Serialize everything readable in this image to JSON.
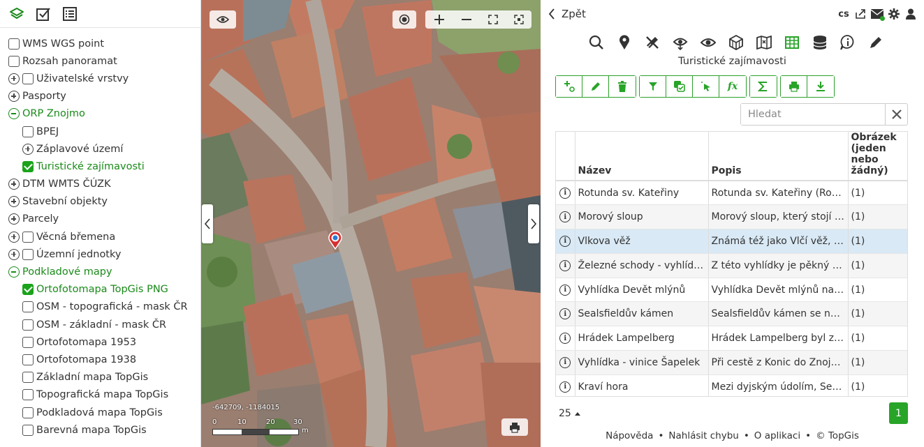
{
  "left_toolbar": {
    "icons": [
      "layers-icon",
      "checklist-icon",
      "list-icon"
    ]
  },
  "layers": [
    {
      "label": "WMS WGS point",
      "checkbox": true,
      "checked": false,
      "expander": null,
      "indent": 0,
      "green": false
    },
    {
      "label": "Rozsah panoramat",
      "checkbox": true,
      "checked": false,
      "expander": null,
      "indent": 0,
      "green": false
    },
    {
      "label": "Uživatelské vrstvy",
      "checkbox": true,
      "checked": false,
      "expander": "plus",
      "indent": 0,
      "green": false
    },
    {
      "label": "Pasporty",
      "checkbox": false,
      "checked": false,
      "expander": "plus",
      "indent": 0,
      "green": false
    },
    {
      "label": "ORP Znojmo",
      "checkbox": false,
      "checked": false,
      "expander": "minus",
      "indent": 0,
      "green": true
    },
    {
      "label": "BPEJ",
      "checkbox": true,
      "checked": false,
      "expander": null,
      "indent": 1,
      "green": false
    },
    {
      "label": "Záplavové území",
      "checkbox": false,
      "checked": false,
      "expander": "plus",
      "indent": 1,
      "green": false
    },
    {
      "label": "Turistické zajímavosti",
      "checkbox": true,
      "checked": true,
      "expander": null,
      "indent": 1,
      "green": true
    },
    {
      "label": "DTM WMTS ČÚZK",
      "checkbox": false,
      "checked": false,
      "expander": "plus",
      "indent": 0,
      "green": false
    },
    {
      "label": "Stavební objekty",
      "checkbox": false,
      "checked": false,
      "expander": "plus",
      "indent": 0,
      "green": false
    },
    {
      "label": "Parcely",
      "checkbox": false,
      "checked": false,
      "expander": "plus",
      "indent": 0,
      "green": false
    },
    {
      "label": "Věcná břemena",
      "checkbox": true,
      "checked": false,
      "expander": "plus",
      "indent": 0,
      "green": false
    },
    {
      "label": "Územní jednotky",
      "checkbox": true,
      "checked": false,
      "expander": "plus",
      "indent": 0,
      "green": false
    },
    {
      "label": "Podkladové mapy",
      "checkbox": false,
      "checked": false,
      "expander": "minus",
      "indent": 0,
      "green": true
    },
    {
      "label": "Ortofotomapa TopGis PNG",
      "checkbox": true,
      "checked": true,
      "expander": null,
      "indent": 1,
      "green": true
    },
    {
      "label": "OSM - topografická - mask ČR",
      "checkbox": true,
      "checked": false,
      "expander": null,
      "indent": 1,
      "green": false
    },
    {
      "label": "OSM - základní - mask ČR",
      "checkbox": true,
      "checked": false,
      "expander": null,
      "indent": 1,
      "green": false
    },
    {
      "label": "Ortofotomapa 1953",
      "checkbox": true,
      "checked": false,
      "expander": null,
      "indent": 1,
      "green": false
    },
    {
      "label": "Ortofotomapa 1938",
      "checkbox": true,
      "checked": false,
      "expander": null,
      "indent": 1,
      "green": false
    },
    {
      "label": "Základní mapa TopGis",
      "checkbox": true,
      "checked": false,
      "expander": null,
      "indent": 1,
      "green": false
    },
    {
      "label": "Topografická mapa TopGis",
      "checkbox": true,
      "checked": false,
      "expander": null,
      "indent": 1,
      "green": false
    },
    {
      "label": "Podkladová mapa TopGis",
      "checkbox": true,
      "checked": false,
      "expander": null,
      "indent": 1,
      "green": false
    },
    {
      "label": "Barevná mapa TopGis",
      "checkbox": true,
      "checked": false,
      "expander": null,
      "indent": 1,
      "green": false
    }
  ],
  "map": {
    "coordinates": "-642709, -1184015",
    "scale_labels": [
      "0",
      "10",
      "20",
      "30"
    ],
    "scale_unit": "m"
  },
  "right": {
    "back_label": "Zpět",
    "language": "cs",
    "section_title": "Turistické zajímavosti",
    "search_placeholder": "Hledat",
    "columns": [
      "Název",
      "Popis",
      "Obrázek (jeden nebo žádný)"
    ],
    "rows": [
      {
        "name": "Rotunda sv. Kateřiny",
        "desc": "Rotunda sv. Kateřiny (Rotunda Panny Marie a sv. Kateřiny)",
        "img": "(1)"
      },
      {
        "name": "Morový sloup",
        "desc": "Morový sloup, který stojí na Horním náměstí",
        "img": "(1)"
      },
      {
        "name": "Vlkova věž",
        "desc": "Známá též jako Vlčí věž, byla součástí",
        "img": "(1)"
      },
      {
        "name": "Železné schody - vyhlídka",
        "desc": "Z této vyhlídky je pěkný pohled na Dyji",
        "img": "(1)"
      },
      {
        "name": "Vyhlídka Devět mlýnů",
        "desc": "Vyhlídka Devět mlýnů nad údolím Dyje",
        "img": "(1)"
      },
      {
        "name": "Sealsfieldův kámen",
        "desc": "Sealsfieldův kámen se nachází nad Dyjí",
        "img": "(1)"
      },
      {
        "name": "Hrádek Lampelberg",
        "desc": "Hrádek Lampelberg byl zbudován",
        "img": "(1)"
      },
      {
        "name": "Vyhlídka - vinice Šapelek",
        "desc": "Při cestě z Konic do Znojma se nachází",
        "img": "(1)"
      },
      {
        "name": "Kraví hora",
        "desc": "Mezi dyjským údolím, Sedlešovicemi a",
        "img": "(1)"
      }
    ],
    "selected_row": 2,
    "page_size": "25",
    "current_page": "1",
    "footer": [
      "Nápověda",
      "Nahlásit chybu",
      "O aplikaci",
      "© TopGis"
    ]
  },
  "colors": {
    "accent": "#28a428",
    "selected_row": "#d9e9f5",
    "alt_row": "#f5f5f5"
  }
}
